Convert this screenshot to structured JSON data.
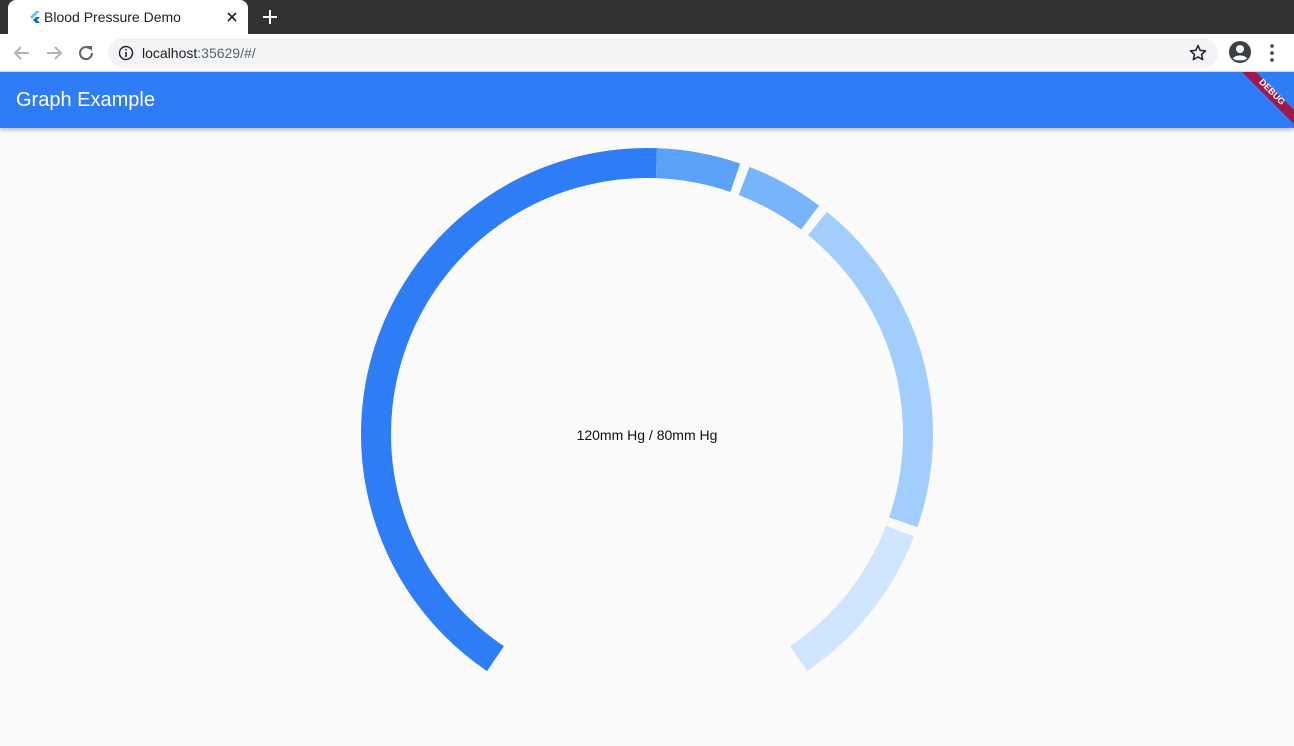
{
  "browser": {
    "tab_title": "Blood Pressure Demo",
    "url_host": "localhost",
    "url_rest": ":35629/#/"
  },
  "appbar": {
    "title": "Graph Example",
    "debug_banner": "DEBUG"
  },
  "gauge": {
    "label": "120mm Hg / 80mm Hg",
    "segments": [
      {
        "start_deg": 214,
        "sweep_deg": 148,
        "color": "#2e7cf6"
      },
      {
        "start_deg": 2,
        "sweep_deg": 17,
        "color": "#5aa2f8"
      },
      {
        "start_deg": 21,
        "sweep_deg": 16,
        "color": "#78b4fa"
      },
      {
        "start_deg": 39,
        "sweep_deg": 70,
        "color": "#a1cefc"
      },
      {
        "start_deg": 111,
        "sweep_deg": 35,
        "color": "#d0e6fe"
      }
    ]
  },
  "colors": {
    "primary": "#2e7cf6",
    "background": "#fafafa",
    "tabstrip": "#323233"
  },
  "icons": [
    "flutter-favicon-icon",
    "tab-close-icon",
    "new-tab-icon",
    "back-icon",
    "forward-icon",
    "reload-icon",
    "site-info-icon",
    "bookmark-star-icon",
    "profile-icon",
    "browser-menu-icon"
  ]
}
